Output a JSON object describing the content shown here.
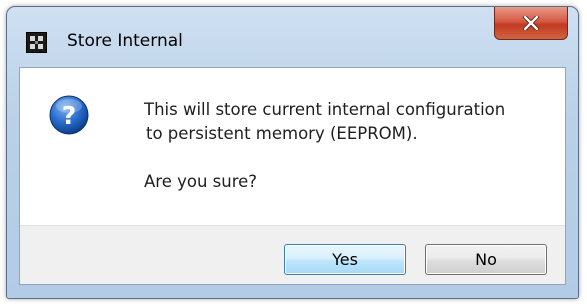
{
  "window": {
    "title": "Store Internal",
    "app_icon": "app-logo-icon",
    "close_icon": "close-icon"
  },
  "message": {
    "icon": "question-icon",
    "line1": "This will store current internal configuration",
    "line2": "to persistent memory (EEPROM).",
    "question": "Are you sure?"
  },
  "buttons": {
    "yes_label": "Yes",
    "no_label": "No"
  },
  "colors": {
    "title_bar": "#b9d0e8",
    "close_button": "#c23a22",
    "question_icon": "#1f5fb5",
    "default_button_border": "#3c7fb1",
    "button_bar": "#f0f0f0"
  }
}
